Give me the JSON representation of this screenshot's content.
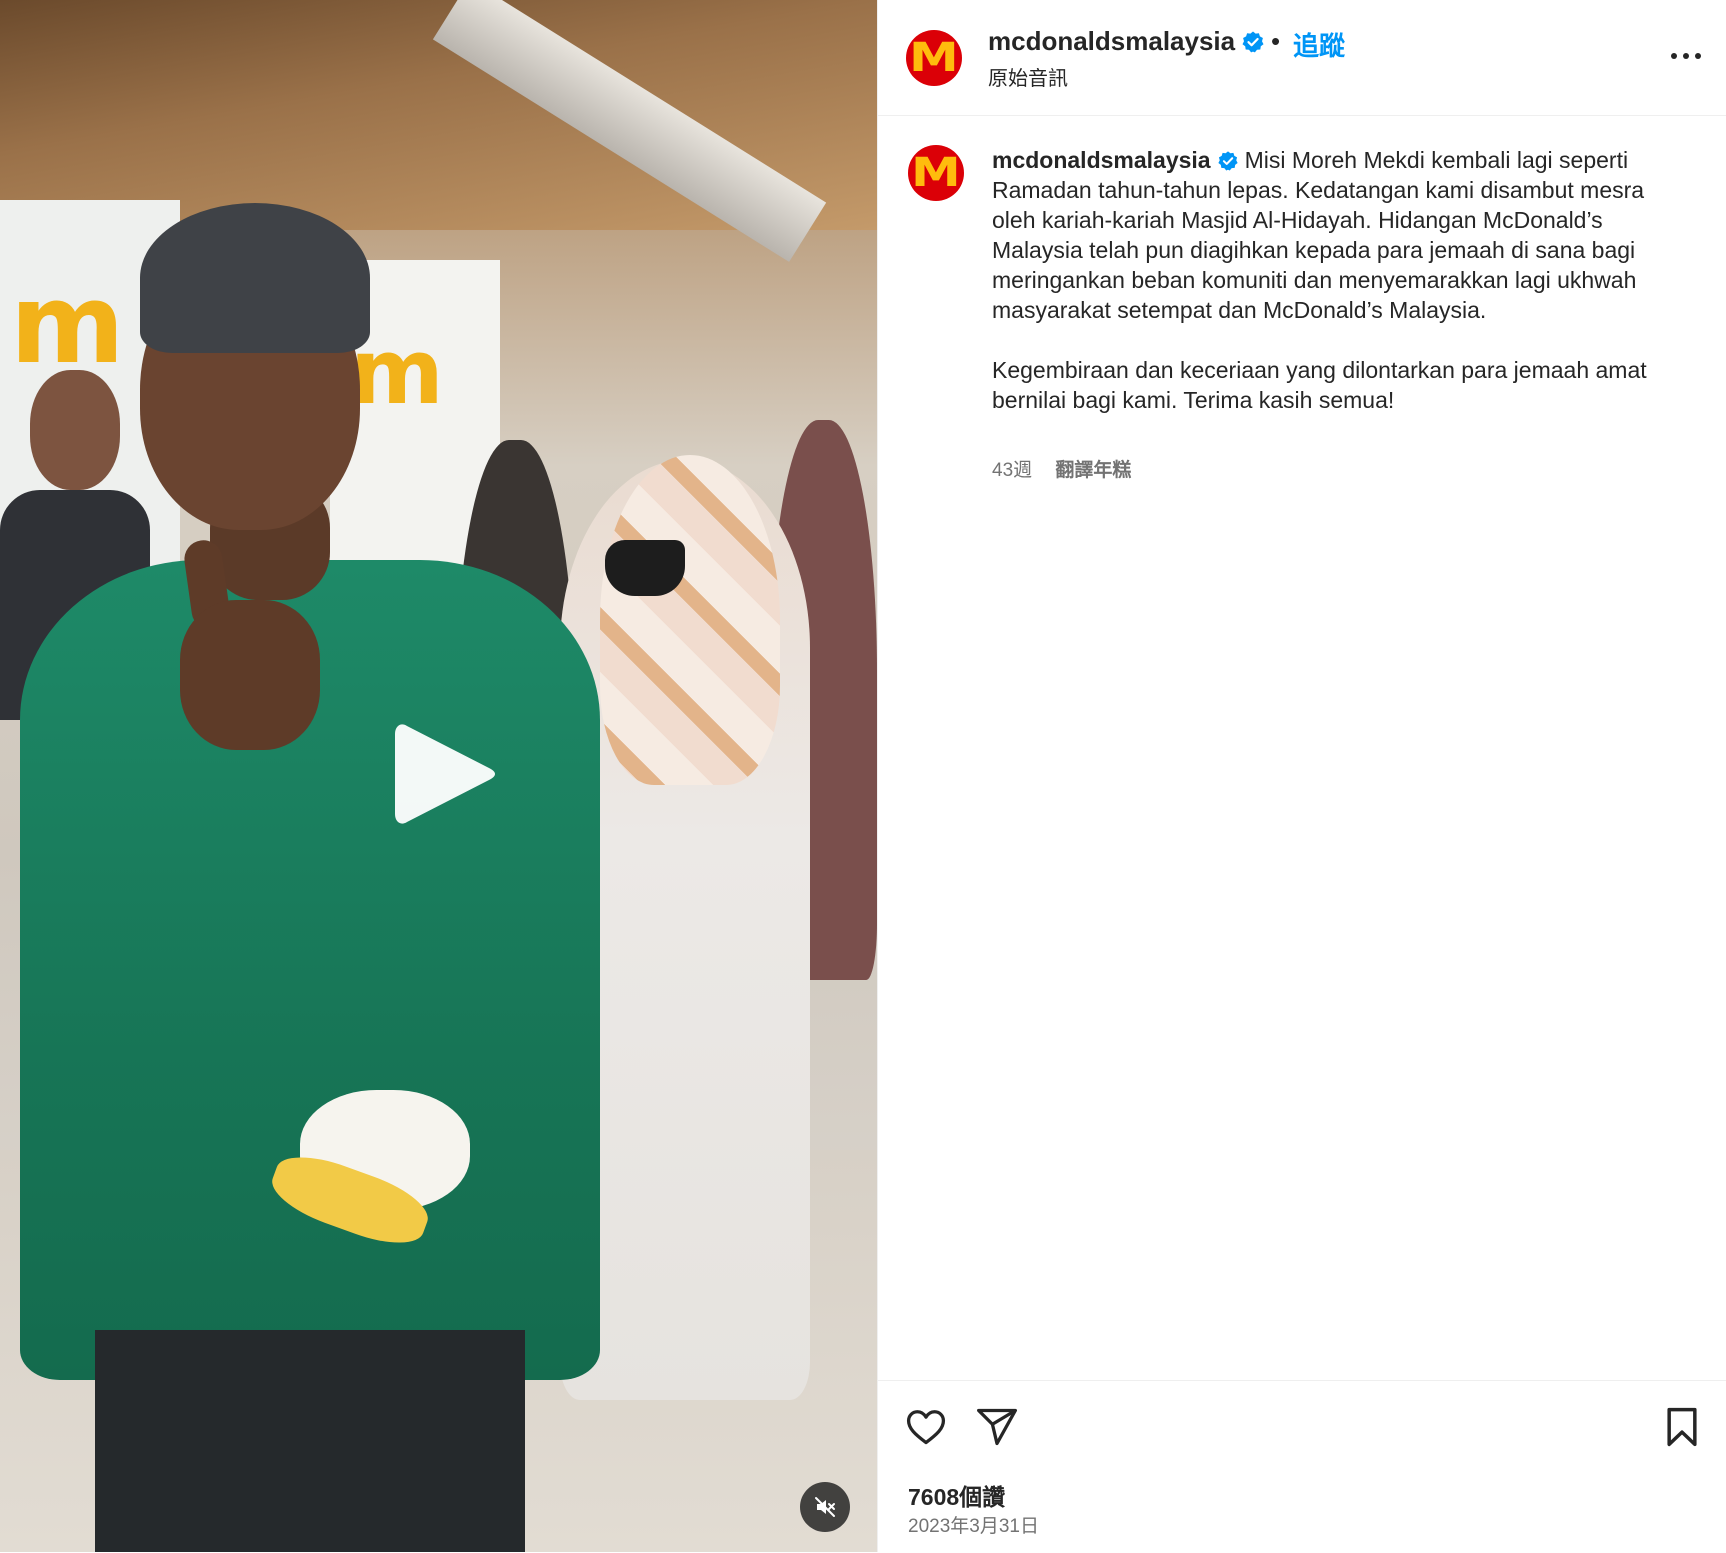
{
  "post": {
    "username": "mcdonaldsmalaysia",
    "separator": "•",
    "follow_label": "追蹤",
    "audio_label": "原始音訊",
    "avatar_letter": "M",
    "caption_paragraph_1": "Misi Moreh Mekdi kembali lagi seperti Ramadan tahun-tahun lepas. Kedatangan kami disambut mesra oleh kariah-kariah Masjid Al-Hidayah. Hidangan McDonald’s Malaysia telah pun diagihkan kepada para jemaah di sana bagi meringankan beban komuniti dan menyemarakkan lagi ukhwah masyarakat setempat dan McDonald’s Malaysia.",
    "caption_paragraph_2": "Kegembiraan dan keceriaan yang dilontarkan para jemaah amat bernilai bagi kami. Terima kasih semua!",
    "time_ago": "43週",
    "translate_label": "翻譯年糕",
    "likes": "7608個讚",
    "date": "2023年3月31日"
  },
  "icons": {
    "verified": "verified-badge-icon",
    "more": "more-options-icon",
    "play": "play-icon",
    "mute": "muted-speaker-icon",
    "like": "heart-icon",
    "share": "paper-plane-icon",
    "save": "bookmark-icon"
  },
  "colors": {
    "accent_blue": "#0095f6",
    "brand_red": "#db0007",
    "brand_yellow": "#ffbc0d",
    "secondary_text": "#737373"
  }
}
